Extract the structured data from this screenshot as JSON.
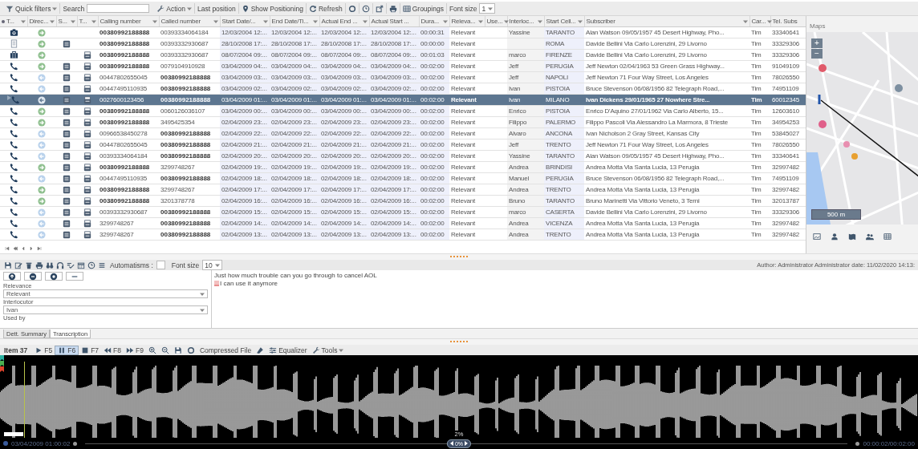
{
  "toolbar": {
    "items": [
      {
        "kind": "filters",
        "label": "Quick filters"
      },
      {
        "kind": "label",
        "label": "Search"
      },
      {
        "kind": "search"
      },
      {
        "kind": "action",
        "label": "Action"
      },
      {
        "kind": "text",
        "label": "Last position"
      },
      {
        "kind": "pin",
        "label": "Show Positioning"
      },
      {
        "kind": "refresh",
        "label": "Refresh"
      },
      {
        "kind": "ring"
      },
      {
        "kind": "clock"
      },
      {
        "kind": "export"
      },
      {
        "kind": "print"
      },
      {
        "kind": "groupings",
        "label": "Groupings"
      },
      {
        "kind": "label",
        "label": "Font size"
      },
      {
        "kind": "select",
        "value": "1"
      }
    ]
  },
  "table": {
    "columns": [
      {
        "label": "T...",
        "filter": true
      },
      {
        "label": "Direc...",
        "filter": true
      },
      {
        "label": "S...",
        "filter": true
      },
      {
        "label": "T...",
        "filter": true
      },
      {
        "label": "Calling number",
        "filter": true
      },
      {
        "label": "Called number",
        "filter": true
      },
      {
        "label": "Start Date/...",
        "filter": true
      },
      {
        "label": "End Date/Ti...",
        "filter": true
      },
      {
        "label": "Actual End ...",
        "filter": true
      },
      {
        "label": "Actual Start ...",
        "filter": false
      },
      {
        "label": "Dura...",
        "filter": true
      },
      {
        "label": "Releva...",
        "filter": true
      },
      {
        "label": "Use...",
        "filter": true
      },
      {
        "label": "Interloc...",
        "filter": true
      },
      {
        "label": "Start Cell...",
        "filter": true
      },
      {
        "label": "Subscriber",
        "filter": true
      },
      {
        "label": "Car...",
        "filter": true
      },
      {
        "label": "Tel. Subs",
        "filter": false
      }
    ],
    "rows": [
      {
        "kind": "photo",
        "outgoing": true,
        "summary": false,
        "transcript": false,
        "calling": "00380992188888",
        "called": "00393334064184",
        "start": "12/03/2004 12:...",
        "end": "12/03/2004 12:...",
        "actual_end": "12/03/2004 12:...",
        "actual_start": "12/03/2004 12:...",
        "duration": "00:00:31",
        "relevance": "Relevant",
        "interlocutor": "Yassine",
        "start_cell": "TARANTO",
        "subscriber": "Alan Watson  09/05/1957  45 Desert Highway, Pho...",
        "carrier": "Tim",
        "tel_subs": "33340641",
        "selected": false
      },
      {
        "kind": "note",
        "outgoing": true,
        "summary": true,
        "transcript": false,
        "calling": "00380992188888",
        "called": "00393332930687",
        "start": "28/10/2008 17:...",
        "end": "28/10/2008 17:...",
        "actual_end": "28/10/2008 17:...",
        "actual_start": "28/10/2008 17:...",
        "duration": "00:00:00",
        "relevance": "Relevant",
        "start_cell": "ROMA",
        "subscriber": "Davide Bellini Via Carlo Lorenzini, 29 Livorno",
        "carrier": "Tim",
        "tel_subs": "33329306",
        "selected": false
      },
      {
        "kind": "case",
        "outgoing": true,
        "summary": false,
        "transcript": true,
        "calling": "00380992188888",
        "called": "00393332930687",
        "start": "08/07/2004 09:...",
        "end": "08/07/2004 09:...",
        "actual_end": "08/07/2004 09:...",
        "actual_start": "08/07/2004 09:...",
        "duration": "00:01:03",
        "relevance": "Relevant",
        "interlocutor": "marco",
        "start_cell": "FIRENZE",
        "subscriber": "Davide Bellini Via Carlo Lorenzini, 29 Livorno",
        "carrier": "Tim",
        "tel_subs": "33329306",
        "selected": false
      },
      {
        "kind": "call",
        "outgoing": true,
        "summary": true,
        "transcript": true,
        "calling": "00380992188888",
        "called": "0079104910928",
        "start": "03/04/2009 04:...",
        "end": "03/04/2009 04:...",
        "actual_end": "03/04/2009 04:...",
        "actual_start": "03/04/2009 04:...",
        "duration": "00:02:00",
        "relevance": "Relevant",
        "interlocutor": "Jeff",
        "start_cell": "PERUGIA",
        "subscriber": "Jeff Newton  02/04/1963  53 Green Grass Highway...",
        "carrier": "Tim",
        "tel_subs": "91049109",
        "selected": false
      },
      {
        "kind": "call",
        "outgoing": false,
        "summary": true,
        "transcript": true,
        "calling": "00447802655045",
        "called": "00380992188888",
        "start": "03/04/2009 03:...",
        "end": "03/04/2009 03:...",
        "actual_end": "03/04/2009 03:...",
        "actual_start": "03/04/2009 03:...",
        "duration": "00:02:00",
        "relevance": "Relevant",
        "interlocutor": "Jeff",
        "start_cell": "NAPOLI",
        "subscriber": "Jeff Newton 71 Four Way Street, Los Angeles",
        "carrier": "Tim",
        "tel_subs": "78026550",
        "selected": false
      },
      {
        "kind": "call",
        "outgoing": false,
        "summary": true,
        "transcript": true,
        "calling": "00447495110935",
        "called": "00380992188888",
        "start": "03/04/2009 02:...",
        "end": "03/04/2009 02:...",
        "actual_end": "03/04/2009 02:...",
        "actual_start": "03/04/2009 02:...",
        "duration": "00:02:00",
        "relevance": "Relevant",
        "interlocutor": "Ivan",
        "start_cell": "PISTOIA",
        "subscriber": "Bruce Stevenson  06/08/1956  82 Telegraph Road,...",
        "carrier": "Tim",
        "tel_subs": "74951109",
        "selected": false
      },
      {
        "kind": "call",
        "outgoing": false,
        "summary": true,
        "transcript": true,
        "calling": "0027600123456",
        "called": "00380992188888",
        "start": "03/04/2009 01:...",
        "end": "03/04/2009 01:...",
        "actual_end": "03/04/2009 01:...",
        "actual_start": "03/04/2009 01:...",
        "duration": "00:02:00",
        "relevance": "Relevant",
        "interlocutor": "Ivan",
        "start_cell": "MILANO",
        "subscriber": "Ivan Dickens  29/01/1965  27 Nowhere Stre...",
        "carrier": "Tim",
        "tel_subs": "60012345",
        "selected": true
      },
      {
        "kind": "call",
        "outgoing": true,
        "summary": true,
        "transcript": true,
        "calling": "00380992188888",
        "called": "0060126036107",
        "start": "03/04/2009 00:...",
        "end": "03/04/2009 00:...",
        "actual_end": "03/04/2009 00:...",
        "actual_start": "03/04/2009 00:...",
        "duration": "00:02:00",
        "relevance": "Relevant",
        "interlocutor": "Enrico",
        "start_cell": "PISTOIA",
        "subscriber": "Enrico D'Aquino  27/01/1962  Via Carlo Alberto, 15...",
        "carrier": "Tim",
        "tel_subs": "12603610",
        "selected": false
      },
      {
        "kind": "call",
        "outgoing": true,
        "summary": true,
        "transcript": true,
        "calling": "00380992188888",
        "called": "3495425354",
        "start": "02/04/2009 23:...",
        "end": "02/04/2009 23:...",
        "actual_end": "02/04/2009 23:...",
        "actual_start": "02/04/2009 23:...",
        "duration": "00:02:00",
        "relevance": "Relevant",
        "interlocutor": "Filippo",
        "start_cell": "PALERMO",
        "subscriber": "Filippo Pascoli Via Alessandro La Marmora, 8 Trieste",
        "carrier": "Tim",
        "tel_subs": "34954253",
        "selected": false
      },
      {
        "kind": "call",
        "outgoing": false,
        "summary": true,
        "transcript": true,
        "calling": "00966538450278",
        "called": "00380992188888",
        "start": "02/04/2009 22:...",
        "end": "02/04/2009 22:...",
        "actual_end": "02/04/2009 22:...",
        "actual_start": "02/04/2009 22:...",
        "duration": "00:02:00",
        "relevance": "Relevant",
        "interlocutor": "Alvaro",
        "start_cell": "ANCONA",
        "subscriber": "Ivan Nicholson 2 Gray Street, Kansas City",
        "carrier": "Tim",
        "tel_subs": "53845027",
        "selected": false
      },
      {
        "kind": "call",
        "outgoing": false,
        "summary": true,
        "transcript": true,
        "calling": "00447802655045",
        "called": "00380992188888",
        "start": "02/04/2009 21:...",
        "end": "02/04/2009 21:...",
        "actual_end": "02/04/2009 21:...",
        "actual_start": "02/04/2009 21:...",
        "duration": "00:02:00",
        "relevance": "Relevant",
        "interlocutor": "Jeff",
        "start_cell": "TRENTO",
        "subscriber": "Jeff Newton 71 Four Way Street, Los Angeles",
        "carrier": "Tim",
        "tel_subs": "78026550",
        "selected": false
      },
      {
        "kind": "call",
        "outgoing": false,
        "summary": true,
        "transcript": true,
        "calling": "00393334064184",
        "called": "00380992188888",
        "start": "02/04/2009 20:...",
        "end": "02/04/2009 20:...",
        "actual_end": "02/04/2009 20:...",
        "actual_start": "02/04/2009 20:...",
        "duration": "00:02:00",
        "relevance": "Relevant",
        "interlocutor": "Yassine",
        "start_cell": "TARANTO",
        "subscriber": "Alan Watson  09/05/1957  45 Desert Highway, Pho...",
        "carrier": "Tim",
        "tel_subs": "33340641",
        "selected": false
      },
      {
        "kind": "call",
        "outgoing": true,
        "summary": true,
        "transcript": true,
        "calling": "00380992188888",
        "called": "3299748267",
        "start": "02/04/2009 19:...",
        "end": "02/04/2009 19:...",
        "actual_end": "02/04/2009 19:...",
        "actual_start": "02/04/2009 19:...",
        "duration": "00:02:00",
        "relevance": "Relevant",
        "interlocutor": "Andrea",
        "start_cell": "BRINDISI",
        "subscriber": "Andrea Motta Via Santa Lucia, 13 Perugia",
        "carrier": "Tim",
        "tel_subs": "32997482",
        "selected": false
      },
      {
        "kind": "call",
        "outgoing": false,
        "summary": true,
        "transcript": true,
        "calling": "00447495110935",
        "called": "00380992188888",
        "start": "02/04/2009 18:...",
        "end": "02/04/2009 18:...",
        "actual_end": "02/04/2009 18:...",
        "actual_start": "02/04/2009 18:...",
        "duration": "00:02:00",
        "relevance": "Relevant",
        "interlocutor": "Manuel",
        "start_cell": "PERUGIA",
        "subscriber": "Bruce Stevenson  06/08/1956  82 Telegraph Road,...",
        "carrier": "Tim",
        "tel_subs": "74951109",
        "selected": false
      },
      {
        "kind": "call",
        "outgoing": true,
        "summary": true,
        "transcript": true,
        "calling": "00380992188888",
        "called": "3299748267",
        "start": "02/04/2009 17:...",
        "end": "02/04/2009 17:...",
        "actual_end": "02/04/2009 17:...",
        "actual_start": "02/04/2009 17:...",
        "duration": "00:02:00",
        "relevance": "Relevant",
        "interlocutor": "Andrea",
        "start_cell": "TRENTO",
        "subscriber": "Andrea Motta Via Santa Lucia, 13 Perugia",
        "carrier": "Tim",
        "tel_subs": "32997482",
        "selected": false
      },
      {
        "kind": "call",
        "outgoing": true,
        "summary": true,
        "transcript": true,
        "calling": "00380992188888",
        "called": "3201378778",
        "start": "02/04/2009 16:...",
        "end": "02/04/2009 16:...",
        "actual_end": "02/04/2009 16:...",
        "actual_start": "02/04/2009 16:...",
        "duration": "00:02:00",
        "relevance": "Relevant",
        "interlocutor": "Bruno",
        "start_cell": "TARANTO",
        "subscriber": "Bruno Marinetti Via Vittorio Veneto, 3 Terni",
        "carrier": "Tim",
        "tel_subs": "32013787",
        "selected": false
      },
      {
        "kind": "call",
        "outgoing": false,
        "summary": true,
        "transcript": true,
        "calling": "00393332930687",
        "called": "00380992188888",
        "start": "02/04/2009 15:...",
        "end": "02/04/2009 15:...",
        "actual_end": "02/04/2009 15:...",
        "actual_start": "02/04/2009 15:...",
        "duration": "00:02:00",
        "relevance": "Relevant",
        "interlocutor": "marco",
        "start_cell": "CASERTA",
        "subscriber": "Davide Bellini Via Carlo Lorenzini, 29 Livorno",
        "carrier": "Tim",
        "tel_subs": "33329306",
        "selected": false
      },
      {
        "kind": "call",
        "outgoing": false,
        "summary": true,
        "transcript": true,
        "calling": "3299748267",
        "called": "00380992188888",
        "start": "02/04/2009 14:...",
        "end": "02/04/2009 14:...",
        "actual_end": "02/04/2009 14:...",
        "actual_start": "02/04/2009 14:...",
        "duration": "00:02:00",
        "relevance": "Relevant",
        "interlocutor": "Andrea",
        "start_cell": "VICENZA",
        "subscriber": "Andrea Motta Via Santa Lucia, 13 Perugia",
        "carrier": "Tim",
        "tel_subs": "32997482",
        "selected": false
      },
      {
        "kind": "call",
        "outgoing": false,
        "summary": true,
        "transcript": true,
        "calling": "3299748267",
        "called": "00380992188888",
        "start": "02/04/2009 13:...",
        "end": "02/04/2009 13:...",
        "actual_end": "02/04/2009 13:...",
        "actual_start": "02/04/2009 13:...",
        "duration": "00:02:00",
        "relevance": "Relevant",
        "interlocutor": "Andrea",
        "start_cell": "TRENTO",
        "subscriber": "Andrea Motta Via Santa Lucia, 13 Perugia",
        "carrier": "Tim",
        "tel_subs": "32997482",
        "selected": false
      }
    ]
  },
  "map": {
    "title": "Maps",
    "zoom_in": "+",
    "zoom_out": "−",
    "scale": "500 m"
  },
  "detail": {
    "toolbar": {
      "automatisms_label": "Automatisms :",
      "automatisms_checked": false,
      "font_size_label": "Font size",
      "font_size": "10"
    },
    "author": "Author: Administrator Administrator date: 11/02/2020 14:13:",
    "fields": [
      {
        "label": "Relevance",
        "value": "Relevant"
      },
      {
        "label": "Interlocutor",
        "value": "Ivan"
      }
    ],
    "used_by_label": "Used by",
    "transcription": [
      "Just how much trouble can you go through to cancel AOL",
      "I can use it anymore"
    ],
    "tabs": [
      {
        "label": "Dett. Summary",
        "selected": false
      },
      {
        "label": "Transcription",
        "selected": true
      }
    ]
  },
  "player": {
    "items": [
      {
        "kind": "item",
        "label": "Item 37"
      },
      {
        "kind": "play",
        "label": "F5",
        "selected": false
      },
      {
        "kind": "pause",
        "label": "F6",
        "selected": true
      },
      {
        "kind": "stop",
        "label": "F7",
        "selected": false
      },
      {
        "kind": "rewind",
        "label": "F8",
        "selected": false
      },
      {
        "kind": "forward",
        "label": "F9",
        "selected": false
      },
      {
        "kind": "zoomin"
      },
      {
        "kind": "zoomout"
      },
      {
        "kind": "save"
      },
      {
        "kind": "ring"
      },
      {
        "kind": "text",
        "label": "Compressed File"
      },
      {
        "kind": "eraser"
      },
      {
        "kind": "equalizer",
        "label": "Equalizer"
      },
      {
        "kind": "tools",
        "label": "Tools"
      }
    ],
    "markers": [
      {
        "color": "#2bb3a3"
      },
      {
        "color": "#4caf50"
      },
      {
        "color": "#e0442c"
      }
    ],
    "playhead": {
      "level": 0.026
    },
    "start_time": "03/04/2009 01:00:02",
    "zoom": {
      "label": "2%",
      "knob": "0%",
      "level": 0.49
    },
    "elapsed": "00:00:02/00:02:00"
  }
}
